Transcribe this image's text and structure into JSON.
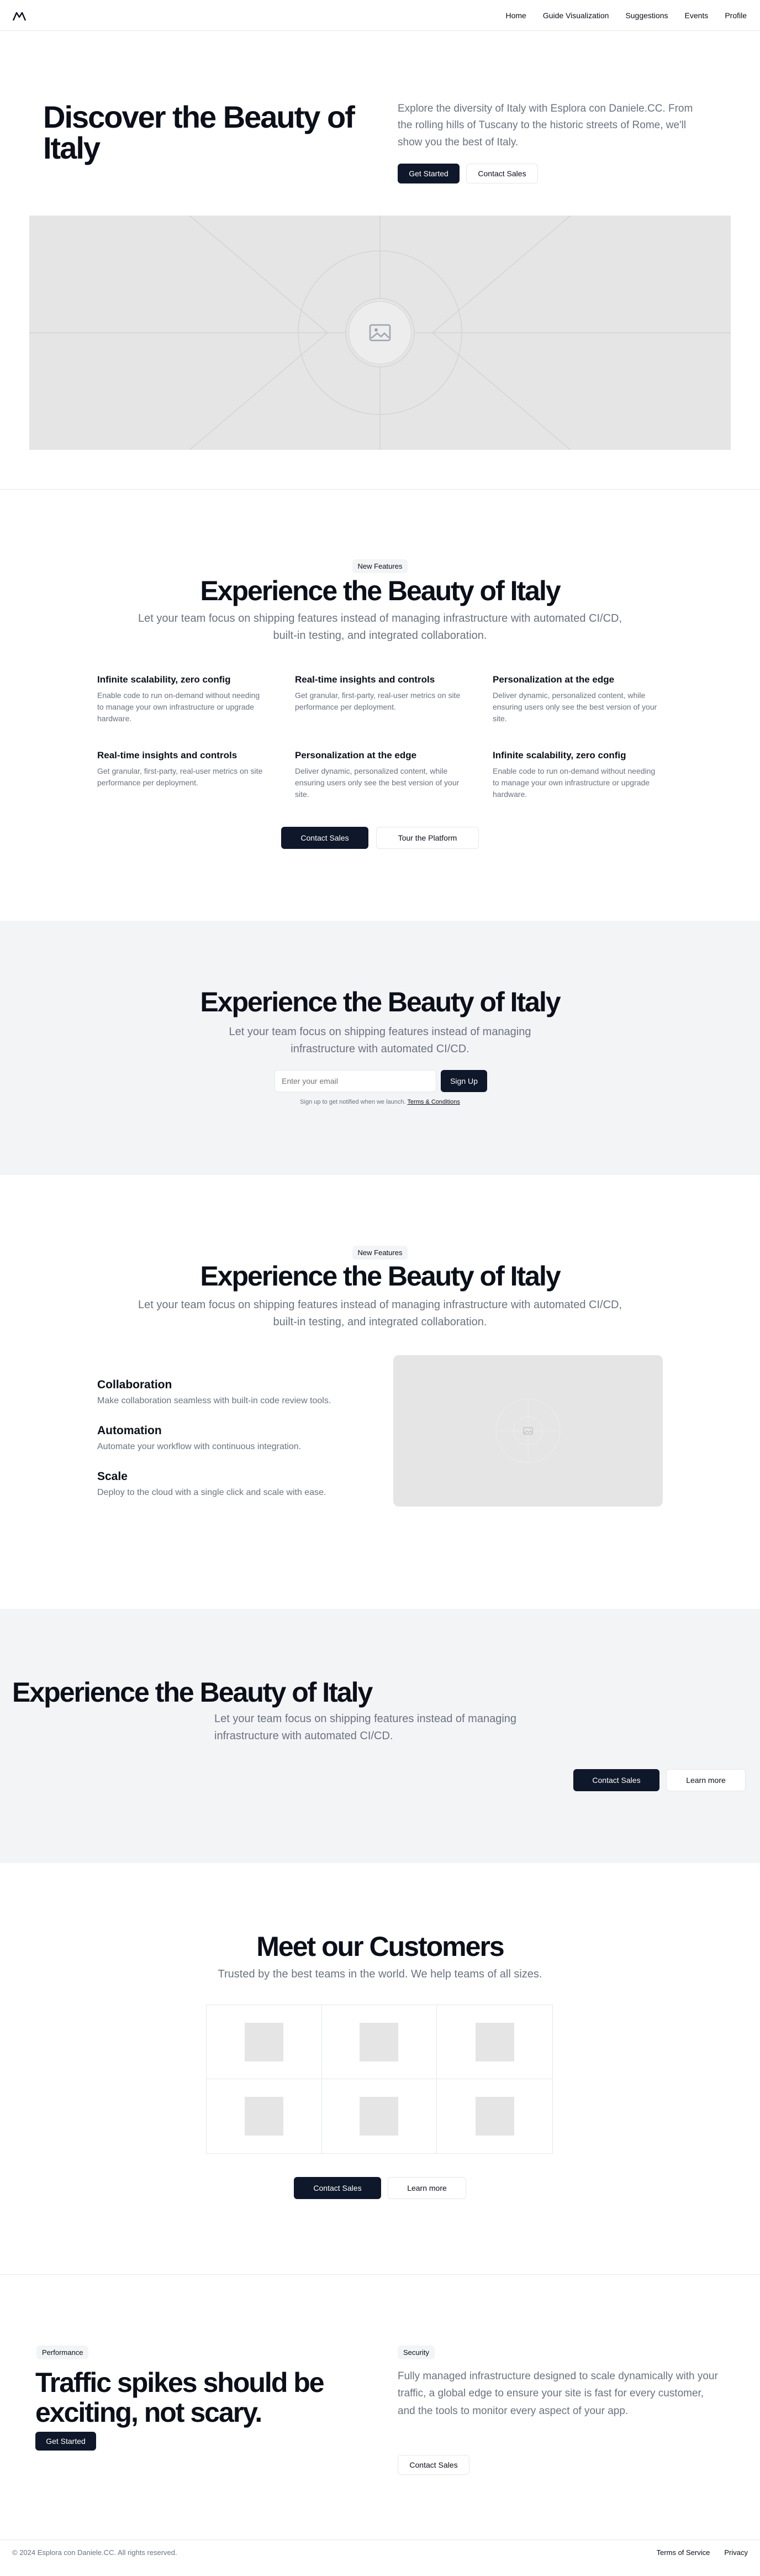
{
  "nav": {
    "items": [
      "Home",
      "Guide Visualization",
      "Suggestions",
      "Events",
      "Profile"
    ],
    "logo": "mountain-logo-icon"
  },
  "hero": {
    "title": "Discover the Beauty of Italy",
    "description": "Explore the diversity of Italy with Esplora con Daniele.CC. From the rolling hills of Tuscany to the historic streets of Rome, we'll show you the best of Italy.",
    "primary": "Get Started",
    "secondary": "Contact Sales"
  },
  "features": {
    "badge": "New Features",
    "title": "Experience the Beauty of Italy",
    "subtitle": "Let your team focus on shipping features instead of managing infrastructure with automated CI/CD, built-in testing, and integrated collaboration.",
    "items": [
      {
        "title": "Infinite scalability, zero config",
        "text": "Enable code to run on-demand without needing to manage your own infrastructure or upgrade hardware."
      },
      {
        "title": "Real-time insights and controls",
        "text": "Get granular, first-party, real-user metrics on site performance per deployment."
      },
      {
        "title": "Personalization at the edge",
        "text": "Deliver dynamic, personalized content, while ensuring users only see the best version of your site."
      },
      {
        "title": "Real-time insights and controls",
        "text": "Get granular, first-party, real-user metrics on site performance per deployment."
      },
      {
        "title": "Personalization at the edge",
        "text": "Deliver dynamic, personalized content, while ensuring users only see the best version of your site."
      },
      {
        "title": "Infinite scalability, zero config",
        "text": "Enable code to run on-demand without needing to manage your own infrastructure or upgrade hardware."
      }
    ],
    "primary": "Contact Sales",
    "secondary": "Tour the Platform"
  },
  "signup": {
    "title": "Experience the Beauty of Italy",
    "subtitle": "Let your team focus on shipping features instead of managing infrastructure with automated CI/CD.",
    "placeholder": "Enter your email",
    "button": "Sign Up",
    "note": "Sign up to get notified when we launch.",
    "terms": "Terms & Conditions"
  },
  "features2": {
    "badge": "New Features",
    "title": "Experience the Beauty of Italy",
    "subtitle": "Let your team focus on shipping features instead of managing infrastructure with automated CI/CD, built-in testing, and integrated collaboration.",
    "items": [
      {
        "title": "Collaboration",
        "text": "Make collaboration seamless with built-in code review tools."
      },
      {
        "title": "Automation",
        "text": "Automate your workflow with continuous integration."
      },
      {
        "title": "Scale",
        "text": "Deploy to the cloud with a single click and scale with ease."
      }
    ]
  },
  "cta": {
    "title": "Experience the Beauty of Italy",
    "subtitle": "Let your team focus on shipping features instead of managing infrastructure with automated CI/CD.",
    "primary": "Contact Sales",
    "secondary": "Learn more"
  },
  "customers": {
    "title": "Meet our Customers",
    "subtitle": "Trusted by the best teams in the world. We help teams of all sizes.",
    "primary": "Contact Sales",
    "secondary": "Learn more"
  },
  "performance": {
    "badge": "Performance",
    "title": "Traffic spikes should be exciting, not scary.",
    "button": "Get Started",
    "badge2": "Security",
    "text": "Fully managed infrastructure designed to scale dynamically with your traffic, a global edge to ensure your site is fast for every customer, and the tools to monitor every aspect of your app.",
    "button2": "Contact Sales"
  },
  "footer": {
    "copyright": "© 2024 Esplora con Daniele.CC. All rights reserved.",
    "links": [
      "Terms of Service",
      "Privacy"
    ]
  }
}
